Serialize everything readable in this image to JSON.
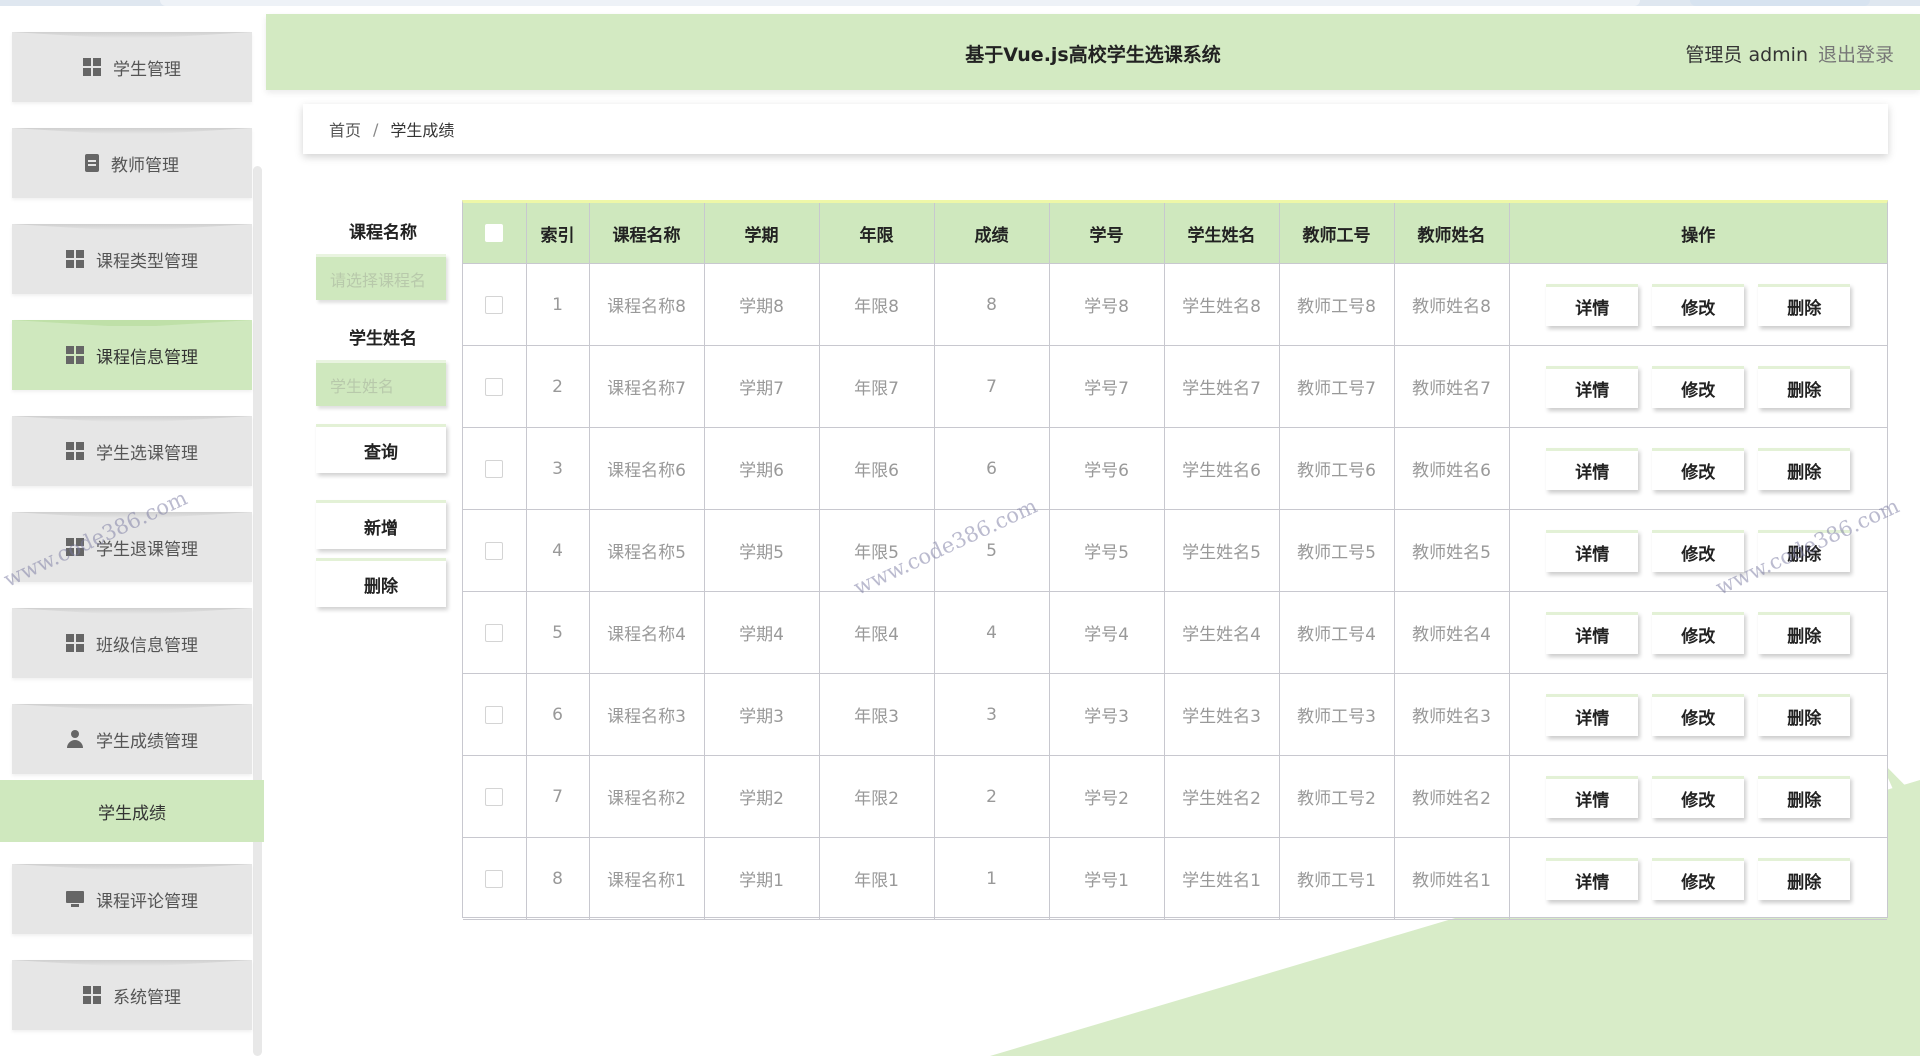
{
  "header": {
    "title": "基于Vue.js高校学生选课系统",
    "user": "管理员 admin",
    "logout": "退出登录"
  },
  "sidebar": {
    "items": [
      {
        "label": "学生管理",
        "icon": "grid-icon"
      },
      {
        "label": "教师管理",
        "icon": "clipboard-icon"
      },
      {
        "label": "课程类型管理",
        "icon": "grid-icon"
      },
      {
        "label": "课程信息管理",
        "icon": "grid-icon"
      },
      {
        "label": "学生选课管理",
        "icon": "grid-icon"
      },
      {
        "label": "学生退课管理",
        "icon": "grid-icon"
      },
      {
        "label": "班级信息管理",
        "icon": "grid-icon"
      },
      {
        "label": "学生成绩管理",
        "icon": "person-icon"
      },
      {
        "label": "课程评论管理",
        "icon": "monitor-icon"
      },
      {
        "label": "系统管理",
        "icon": "grid-icon"
      }
    ],
    "sub_item": "学生成绩"
  },
  "breadcrumb": {
    "home": "首页",
    "separator": "/",
    "current": "学生成绩"
  },
  "search": {
    "course_label": "课程名称",
    "course_placeholder": "请选择课程名",
    "student_label": "学生姓名",
    "student_placeholder": "学生姓名",
    "query_btn": "查询",
    "add_btn": "新增",
    "delete_btn": "删除"
  },
  "table": {
    "headers": [
      "索引",
      "课程名称",
      "学期",
      "年限",
      "成绩",
      "学号",
      "学生姓名",
      "教师工号",
      "教师姓名",
      "操作"
    ],
    "rows": [
      [
        "1",
        "课程名称8",
        "学期8",
        "年限8",
        "8",
        "学号8",
        "学生姓名8",
        "教师工号8",
        "教师姓名8"
      ],
      [
        "2",
        "课程名称7",
        "学期7",
        "年限7",
        "7",
        "学号7",
        "学生姓名7",
        "教师工号7",
        "教师姓名7"
      ],
      [
        "3",
        "课程名称6",
        "学期6",
        "年限6",
        "6",
        "学号6",
        "学生姓名6",
        "教师工号6",
        "教师姓名6"
      ],
      [
        "4",
        "课程名称5",
        "学期5",
        "年限5",
        "5",
        "学号5",
        "学生姓名5",
        "教师工号5",
        "教师姓名5"
      ],
      [
        "5",
        "课程名称4",
        "学期4",
        "年限4",
        "4",
        "学号4",
        "学生姓名4",
        "教师工号4",
        "教师姓名4"
      ],
      [
        "6",
        "课程名称3",
        "学期3",
        "年限3",
        "3",
        "学号3",
        "学生姓名3",
        "教师工号3",
        "教师姓名3"
      ],
      [
        "7",
        "课程名称2",
        "学期2",
        "年限2",
        "2",
        "学号2",
        "学生姓名2",
        "教师工号2",
        "教师姓名2"
      ],
      [
        "8",
        "课程名称1",
        "学期1",
        "年限1",
        "1",
        "学号1",
        "学生姓名1",
        "教师工号1",
        "教师姓名1"
      ]
    ],
    "actions": {
      "detail": "详情",
      "edit": "修改",
      "delete": "删除"
    }
  },
  "watermark": "www.code386.com",
  "colors": {
    "accent": "#cfe8be",
    "header_bg": "#d3eac2",
    "sidebar_item_bg": "#e6e6e6"
  }
}
